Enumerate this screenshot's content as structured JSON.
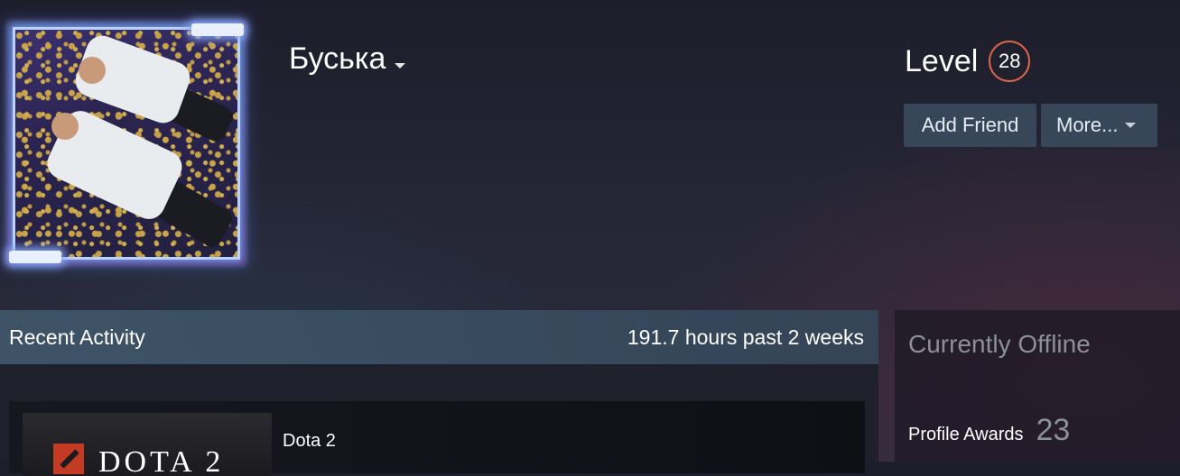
{
  "profile": {
    "username": "Буська",
    "level_label": "Level",
    "level_value": "28",
    "level_color": "#d9664a"
  },
  "actions": {
    "add_friend": "Add Friend",
    "more": "More..."
  },
  "recent_activity": {
    "title": "Recent Activity",
    "hours": "191.7 hours past 2 weeks",
    "games": [
      {
        "name": "Dota 2",
        "thumb_text": "DOTA 2"
      }
    ]
  },
  "sidebar": {
    "status": "Currently Offline",
    "awards_label": "Profile Awards",
    "awards_count": "23"
  }
}
